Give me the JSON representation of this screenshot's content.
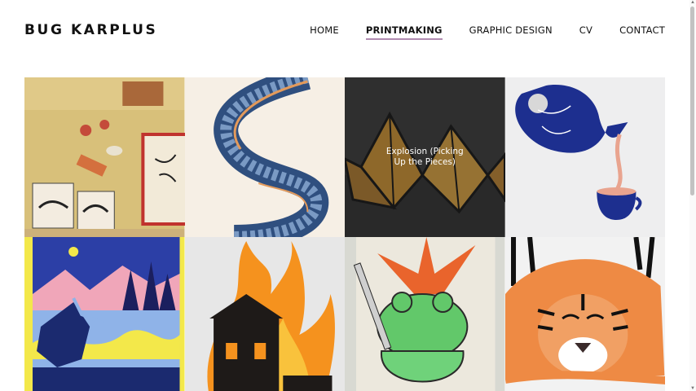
{
  "site": {
    "logo": "BUG KARPLUS"
  },
  "nav": {
    "items": [
      {
        "label": "HOME",
        "active": false
      },
      {
        "label": "PRINTMAKING",
        "active": true
      },
      {
        "label": "GRAPHIC DESIGN",
        "active": false
      },
      {
        "label": "CV",
        "active": false
      },
      {
        "label": "CONTACT",
        "active": false
      }
    ]
  },
  "gallery": {
    "items": [
      {
        "icon": "tiger-print-studio-image",
        "caption": ""
      },
      {
        "icon": "blue-ribbon-s-image",
        "caption": ""
      },
      {
        "icon": "folded-geometric-sculpture-image",
        "caption": "Explosion (Picking Up the Pieces)",
        "hovered": true
      },
      {
        "icon": "blue-teapot-image",
        "caption": ""
      },
      {
        "icon": "lake-scene-print-image",
        "caption": ""
      },
      {
        "icon": "burning-house-print-image",
        "caption": ""
      },
      {
        "icon": "frog-samurai-print-image",
        "caption": ""
      },
      {
        "icon": "tiger-head-print-image",
        "caption": ""
      }
    ]
  },
  "colors": {
    "accent": "#b08ab0",
    "text": "#111111"
  }
}
